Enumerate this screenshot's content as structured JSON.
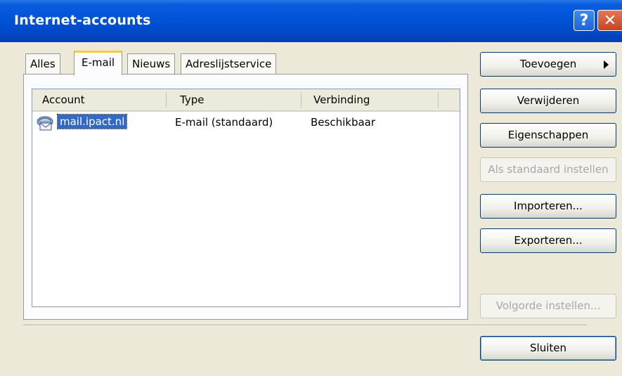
{
  "window": {
    "title": "Internet-accounts",
    "help_glyph": "?",
    "close_glyph": "✕"
  },
  "tabs": [
    {
      "label": "Alles",
      "active": false
    },
    {
      "label": "E-mail",
      "active": true
    },
    {
      "label": "Nieuws",
      "active": false
    },
    {
      "label": "Adreslijstservice",
      "active": false
    }
  ],
  "list": {
    "columns": [
      "Account",
      "Type",
      "Verbinding"
    ],
    "rows": [
      {
        "account": "mail.ipact.nl",
        "type": "E-mail (standaard)",
        "connection": "Beschikbaar",
        "icon": "mail-account-icon",
        "selected": true
      }
    ]
  },
  "buttons": {
    "add": "Toevoegen",
    "remove": "Verwijderen",
    "properties": "Eigenschappen",
    "set_default": "Als standaard instellen",
    "import": "Importeren...",
    "export": "Exporteren...",
    "set_order": "Volgorde instellen...",
    "close": "Sluiten"
  },
  "colors": {
    "titlebar": "#0052d6",
    "selection": "#316ac5",
    "active_tab_accent": "#ffc83c"
  }
}
